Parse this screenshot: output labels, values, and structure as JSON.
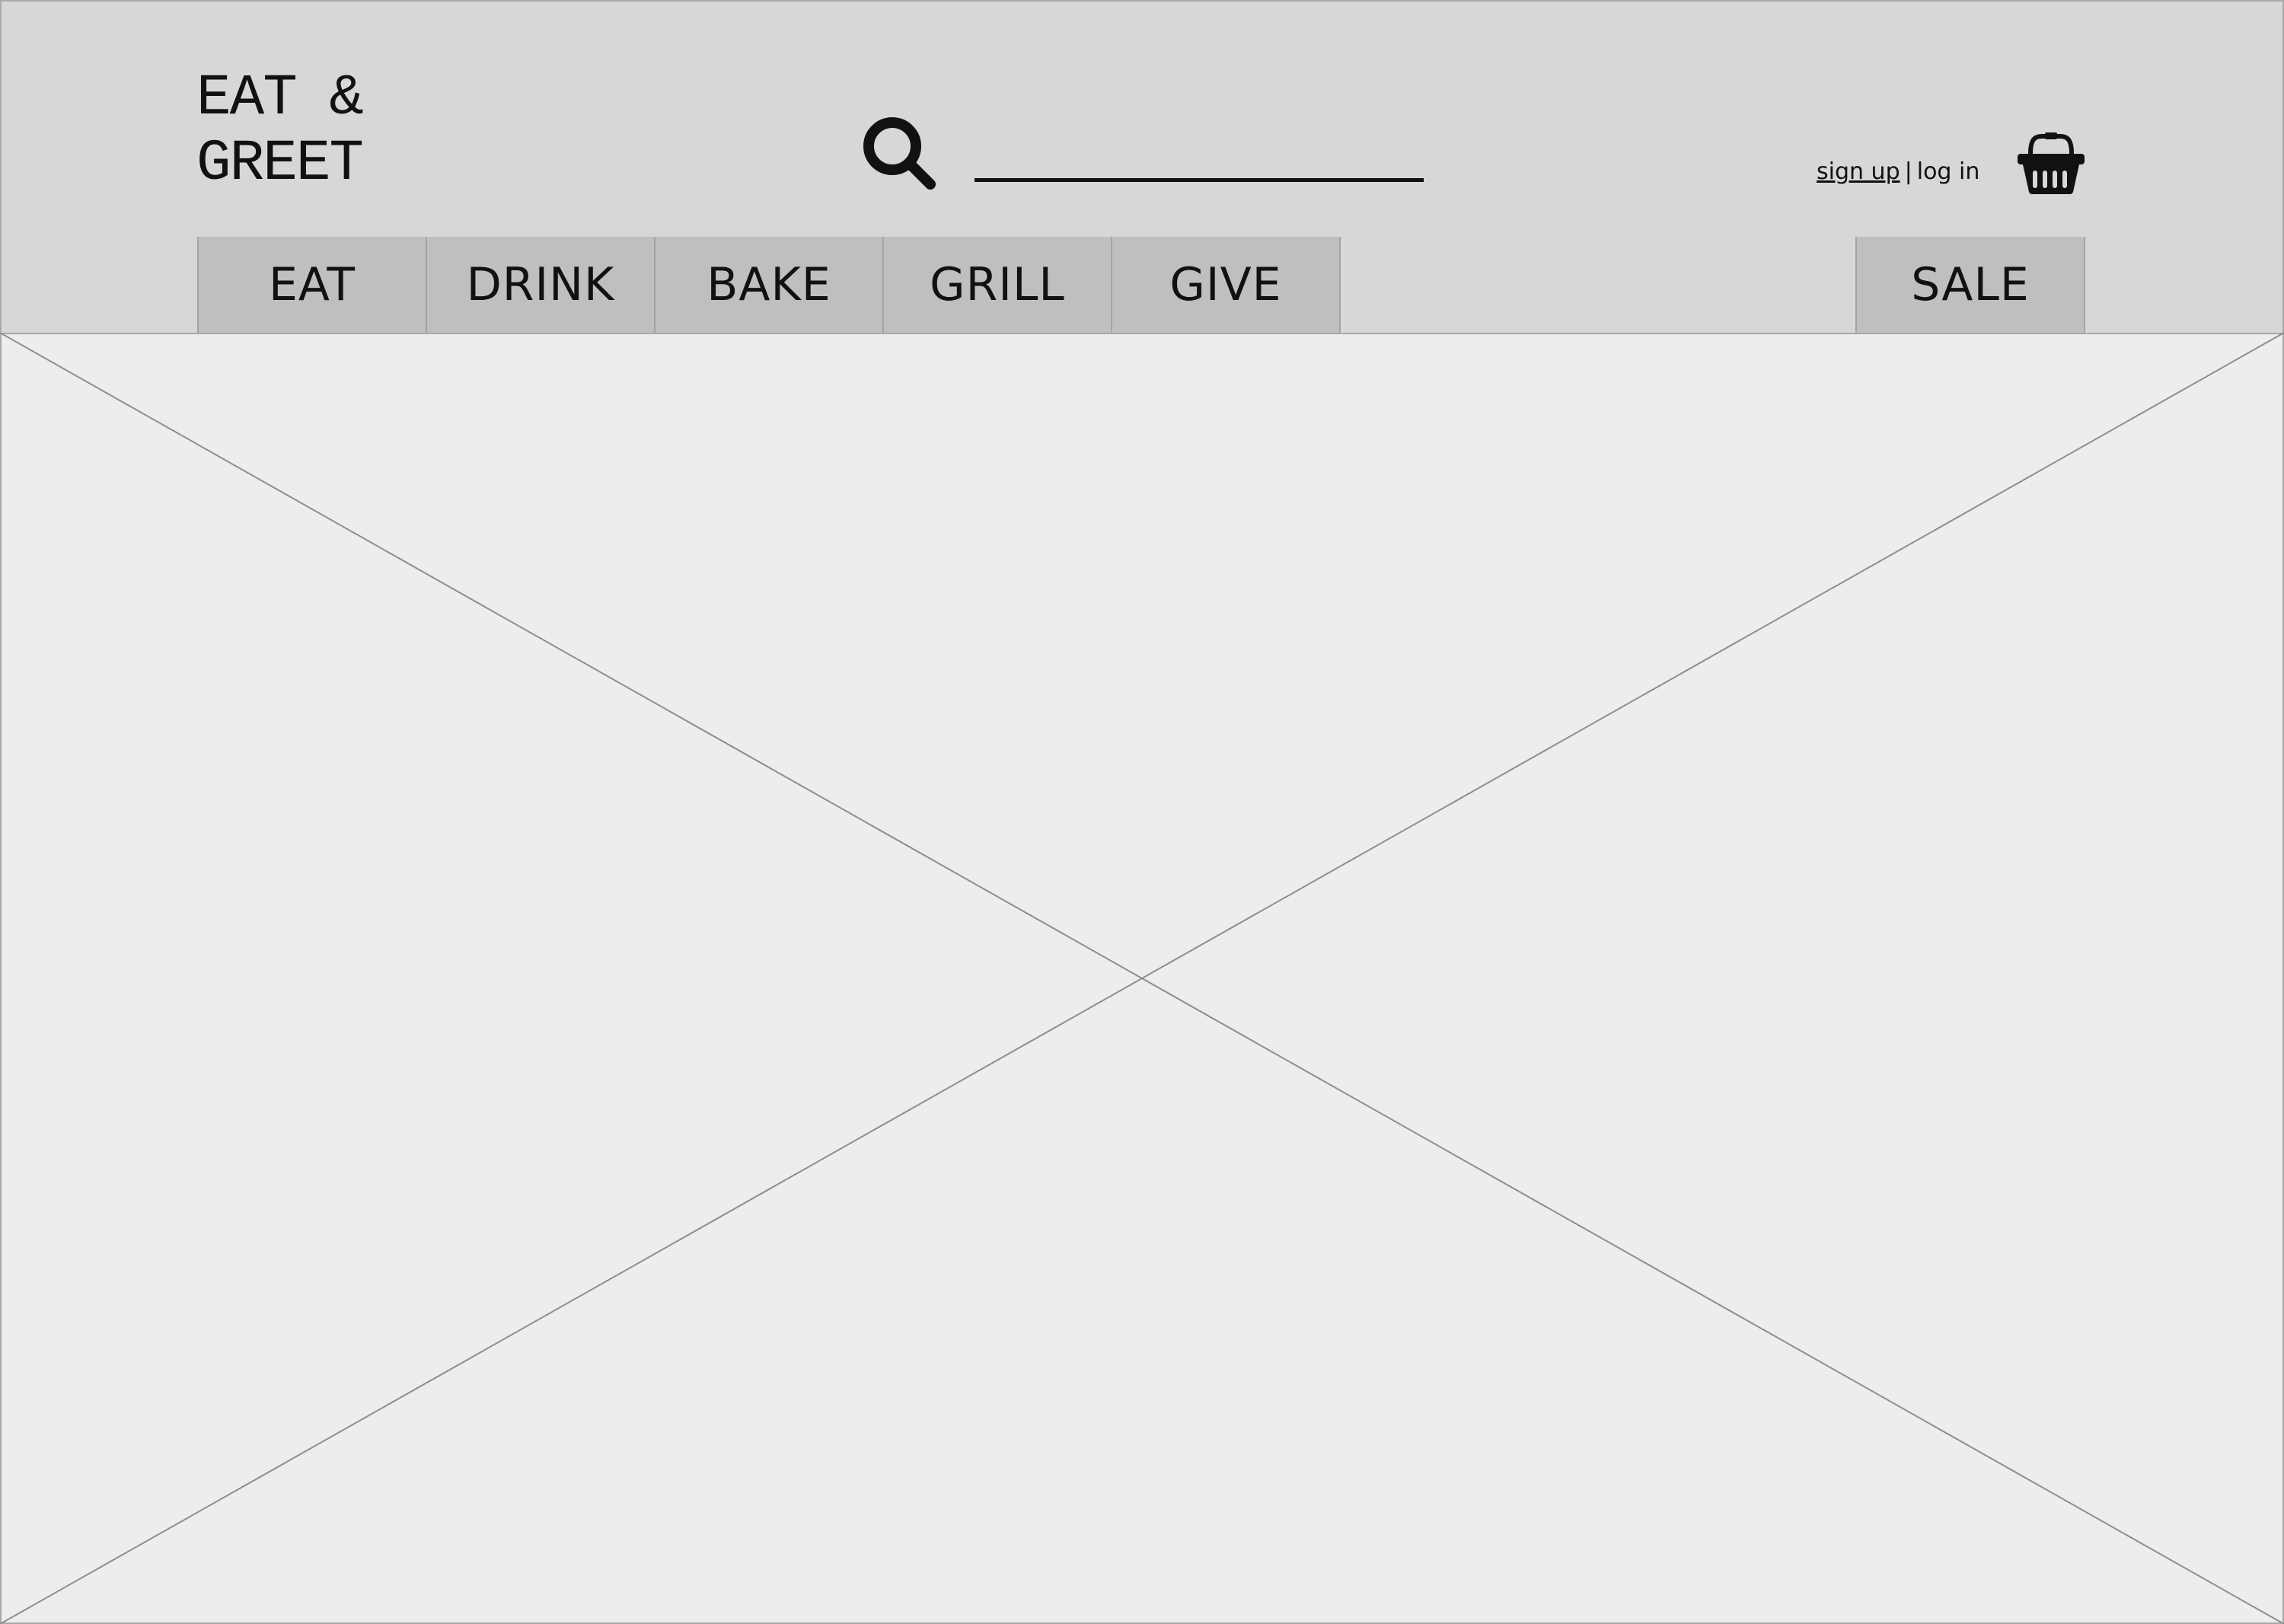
{
  "header": {
    "logo_line1": "EAT &",
    "logo_line2": "GREET",
    "search": {
      "icon": "search-icon",
      "value": "",
      "placeholder": ""
    },
    "auth": {
      "sign_up": "sign up",
      "separator": "|",
      "log_in": "log in"
    },
    "cart": {
      "icon": "basket-icon"
    }
  },
  "nav": {
    "tabs": [
      {
        "label": "EAT"
      },
      {
        "label": "DRINK"
      },
      {
        "label": "BAKE"
      },
      {
        "label": "GRILL"
      },
      {
        "label": "GIVE"
      }
    ],
    "sale": {
      "label": "SALE"
    }
  },
  "main": {
    "placeholder": "image-placeholder"
  },
  "colors": {
    "header_bg": "#d7d7d7",
    "tab_bg": "#bfbfbf",
    "content_bg": "#ededed",
    "border": "#a9a9a9",
    "text": "#111111"
  }
}
